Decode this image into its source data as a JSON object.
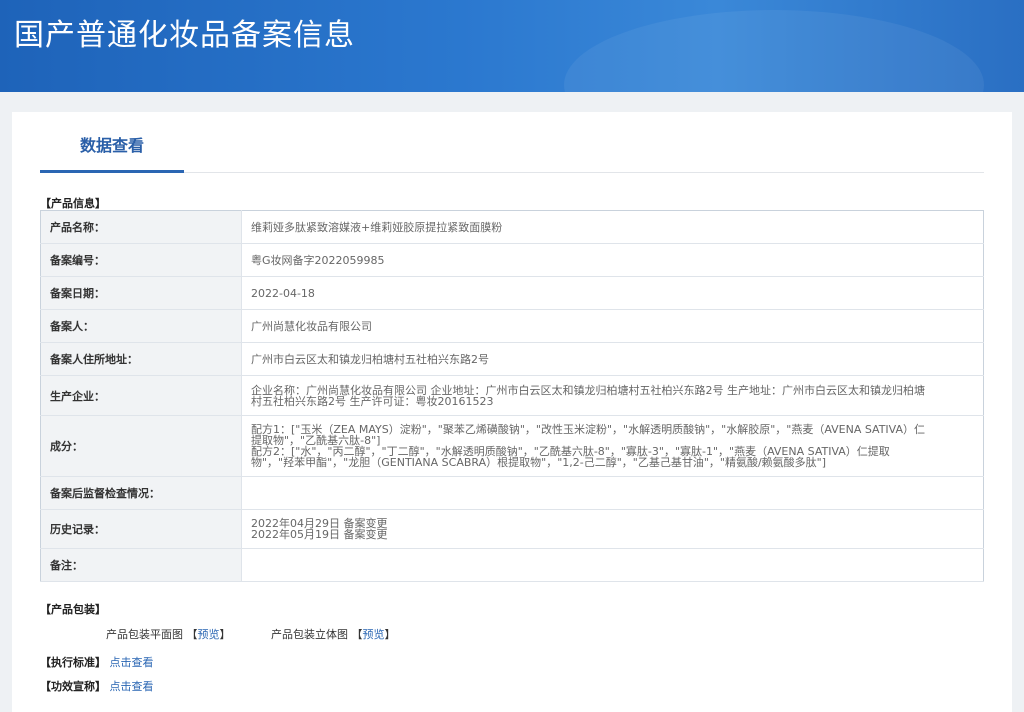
{
  "header": {
    "title": "国产普通化妆品备案信息"
  },
  "tabs": [
    {
      "label": "数据查看"
    }
  ],
  "product_info": {
    "section_title": "【产品信息】",
    "rows": [
      {
        "label": "产品名称：",
        "lines": [
          "维莉娅多肽紧致溶媒液+维莉娅胶原提拉紧致面膜粉"
        ]
      },
      {
        "label": "备案编号：",
        "lines": [
          "粤G妆网备字2022059985"
        ]
      },
      {
        "label": "备案日期：",
        "lines": [
          "2022-04-18"
        ]
      },
      {
        "label": "备案人：",
        "lines": [
          "广州尚慧化妆品有限公司"
        ]
      },
      {
        "label": "备案人住所地址：",
        "lines": [
          "广州市白云区太和镇龙归柏塘村五社柏兴东路2号"
        ]
      },
      {
        "label": "生产企业：",
        "lines": [
          "企业名称：广州尚慧化妆品有限公司 企业地址：广州市白云区太和镇龙归柏塘村五社柏兴东路2号 生产地址：广州市白云区太和镇龙归柏塘",
          "村五社柏兴东路2号 生产许可证：粤妆20161523"
        ]
      },
      {
        "label": "成分：",
        "lines": [
          "配方1：[\"玉米（ZEA MAYS）淀粉\"，\"聚苯乙烯磺酸钠\"，\"改性玉米淀粉\"，\"水解透明质酸钠\"，\"水解胶原\"，\"燕麦（AVENA SATIVA）仁",
          "提取物\"，\"乙酰基六肽-8\"]",
          "配方2：[\"水\"，\"丙二醇\"，\"丁二醇\"，\"水解透明质酸钠\"，\"乙酰基六肽-8\"，\"寡肽-3\"，\"寡肽-1\"，\"燕麦（AVENA SATIVA）仁提取",
          "物\"，\"羟苯甲酯\"，\"龙胆（GENTIANA SCABRA）根提取物\"，\"1,2-己二醇\"，\"乙基己基甘油\"，\"精氨酸/赖氨酸多肽\"]"
        ]
      },
      {
        "label": "备案后监督检查情况：",
        "lines": [
          ""
        ]
      },
      {
        "label": "历史记录：",
        "lines": [
          "2022年04月29日 备案变更",
          "2022年05月19日 备案变更"
        ]
      },
      {
        "label": "备注：",
        "lines": [
          ""
        ]
      }
    ]
  },
  "packaging": {
    "section_title": "【产品包装】",
    "flat_label": "产品包装平面图",
    "solid_label": "产品包装立体图",
    "preview_link": "预览",
    "bracket_open": "【",
    "bracket_close": "】"
  },
  "standard": {
    "section_title": "【执行标准】",
    "link": "点击查看"
  },
  "efficacy": {
    "section_title": "【功效宣称】",
    "link": "点击查看"
  }
}
